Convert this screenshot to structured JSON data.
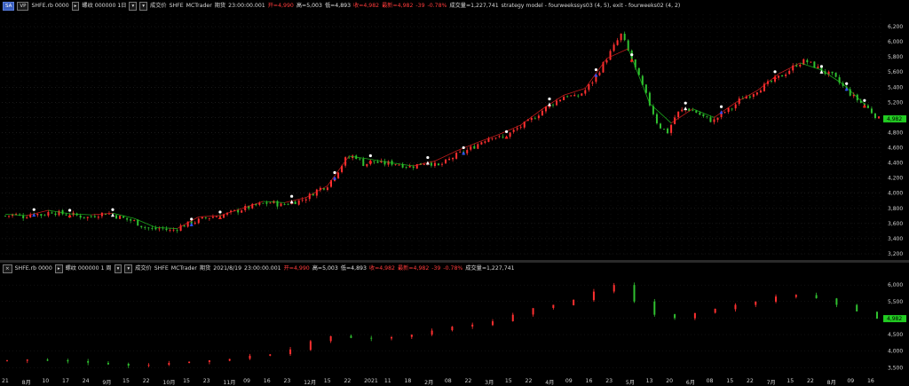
{
  "top_pane": {
    "buttons": [
      "SA",
      "VP"
    ],
    "symbol": "SHFE.rb 0000",
    "bar_desc": "螺纹 000000  1日",
    "menu": "成交价",
    "exchange": "SHFE",
    "source": "MCTrader",
    "fields": [
      "期货",
      "23:00:00.001"
    ],
    "open": "开=4,990",
    "high": "高=5,003",
    "low": "低=4,893",
    "close": "收=4,982",
    "last": "最新=4,982",
    "change": "-39",
    "change_pct": "-0.78%",
    "volume": "成交量=1,227,741",
    "strategy": "strategy model - fourweekssys03 (4, 5), exit - fourweeks02 (4, 2)",
    "price_axis": [
      "6,200",
      "6,000",
      "5,800",
      "5,600",
      "5,400",
      "5,200",
      "5,000",
      "4,800",
      "4,600",
      "4,400",
      "4,200",
      "4,000",
      "3,800",
      "3,600",
      "3,400",
      "3,200"
    ],
    "last_price_tag": "4,982"
  },
  "bottom_pane": {
    "symbol": "SHFE.rb 0000",
    "bar_desc": "螺纹 000000  1 周",
    "menu": "成交价",
    "exchange": "SHFE",
    "source": "MCTrader",
    "fields": [
      "期货",
      "2021/8/19",
      "23:00:00.001"
    ],
    "open": "开=4,990",
    "high": "高=5,003",
    "low": "低=4,893",
    "close": "收=4,982",
    "last": "最新=4,982",
    "change": "-39",
    "change_pct": "-0.78%",
    "volume": "成交量=1,227,741",
    "price_axis": [
      "6,000",
      "5,500",
      "5,000",
      "4,500",
      "4,000",
      "3,500"
    ],
    "last_price_tag": "4,982"
  },
  "time_axis": [
    "21",
    "8月",
    "10",
    "17",
    "24",
    "9月",
    "15",
    "22",
    "10月",
    "15",
    "23",
    "11月",
    "09",
    "16",
    "23",
    "12月",
    "15",
    "22",
    "2021",
    "11",
    "18",
    "2月",
    "08",
    "22",
    "3月",
    "15",
    "22",
    "4月",
    "09",
    "16",
    "23",
    "5月",
    "13",
    "20",
    "6月",
    "08",
    "15",
    "22",
    "7月",
    "15",
    "22",
    "8月",
    "09",
    "16"
  ],
  "colors": {
    "up": "#ff3030",
    "down": "#30c030",
    "bg": "#000000",
    "trend_red": "#e02020",
    "trend_green": "#20c020"
  },
  "chart_data": {
    "type": "candlestick",
    "daily_close_path": [
      3700,
      3720,
      3690,
      3740,
      3710,
      3760,
      3730,
      3720,
      3700,
      3680,
      3720,
      3740,
      3700,
      3660,
      3630,
      3560,
      3520,
      3540,
      3500,
      3560,
      3600,
      3640,
      3680,
      3700,
      3720,
      3760,
      3800,
      3830,
      3860,
      3880,
      3840,
      3880,
      3900,
      3960,
      4050,
      4100,
      4260,
      4450,
      4500,
      4380,
      4420,
      4390,
      4400,
      4380,
      4350,
      4380,
      4420,
      4350,
      4420,
      4500,
      4550,
      4620,
      4700,
      4760,
      4720,
      4800,
      4880,
      4950,
      5050,
      5150,
      5220,
      5300,
      5260,
      5350,
      5500,
      5700,
      5900,
      6100,
      5800,
      5500,
      5200,
      4900,
      4800,
      5050,
      5120,
      5080,
      5000,
      4950,
      5060,
      5120,
      5250,
      5300,
      5380,
      5450,
      5520,
      5600,
      5700,
      5750,
      5680,
      5600,
      5550,
      5420,
      5300,
      5200,
      5100,
      4980
    ],
    "weekly_close_path": [
      3720,
      3740,
      3710,
      3690,
      3650,
      3600,
      3560,
      3580,
      3640,
      3680,
      3720,
      3760,
      3860,
      3900,
      4050,
      4300,
      4450,
      4400,
      4380,
      4420,
      4500,
      4620,
      4740,
      4800,
      4900,
      5100,
      5300,
      5400,
      5550,
      5800,
      6000,
      5500,
      5100,
      5000,
      5150,
      5280,
      5400,
      5500,
      5650,
      5700,
      5600,
      5400,
      5200,
      4982
    ],
    "price_range": [
      3200,
      6200
    ]
  }
}
